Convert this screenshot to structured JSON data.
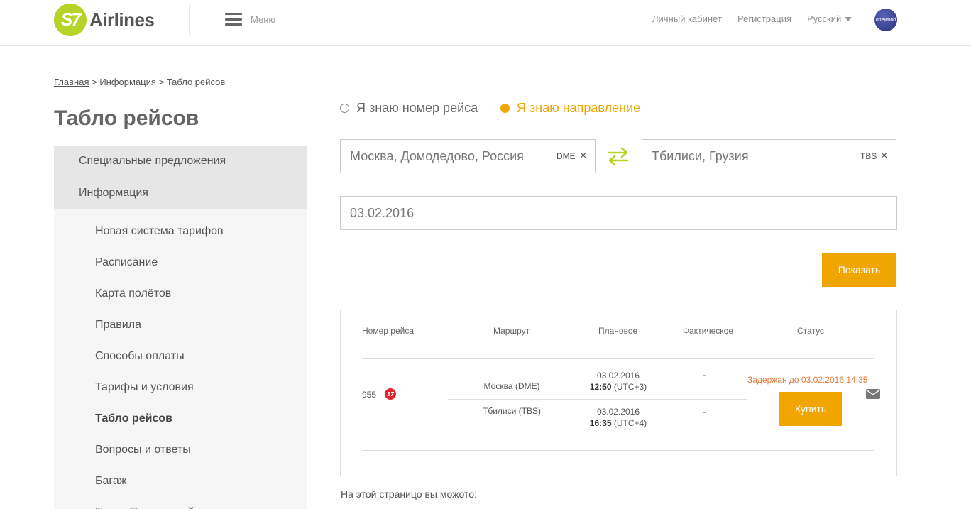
{
  "header": {
    "logo_mark": "S7",
    "logo_text": "Airlines",
    "menu_label": "Меню",
    "links": [
      "Личный кабинет",
      "Регистрация"
    ],
    "language": "Русский",
    "alliance_logo": "oneworld"
  },
  "breadcrumb": {
    "items": [
      "Главная",
      "Информация",
      "Табло рейсов"
    ],
    "separator": ">"
  },
  "page_title": "Табло рейсов",
  "sidebar": {
    "top_items": [
      "Специальные предложения",
      "Информация"
    ],
    "sub_items": [
      "Новая система тарифов",
      "Расписание",
      "Карта полётов",
      "Правила",
      "Способы оплаты",
      "Тарифы и условия",
      "Табло рейсов",
      "Вопросы и ответы",
      "Багаж",
      "Бонус Паспортный"
    ],
    "active_sub": "Табло рейсов"
  },
  "search": {
    "radio_flight_number": "Я знаю номер рейса",
    "radio_direction": "Я знаю направление",
    "selected_radio": "direction",
    "from_value": "Москва, Домодедово, Россия",
    "from_code": "DME",
    "to_value": "Тбилиси, Грузия",
    "to_code": "TBS",
    "clear_glyph": "×",
    "date_value": "03.02.2016",
    "show_button": "Показать"
  },
  "results": {
    "headers": [
      "Номер рейса",
      "Маршрут",
      "Плановое",
      "Фактическое",
      "Статус"
    ],
    "rows": [
      {
        "flight_number": "955",
        "airline_badge": "S7",
        "departure": {
          "route": "Москва (DME)",
          "date": "03.02.2016",
          "time": "12:50",
          "tz": "(UTC+3)",
          "actual": "-"
        },
        "arrival": {
          "route": "Тбилиси (TBS)",
          "date": "03.02.2016",
          "time": "16:35",
          "tz": "(UTC+4)",
          "actual": "-"
        },
        "status": "Задержан до 03.02.2016 14:35",
        "buy_label": "Купить",
        "notify_icon": "mail-icon"
      }
    ]
  },
  "bottom_note": "На этой страницо вы можото:",
  "colors": {
    "brand_green": "#b6d327",
    "accent_orange": "#f0a500",
    "status_delay": "#e07b39",
    "s7_red": "#e5222e"
  }
}
